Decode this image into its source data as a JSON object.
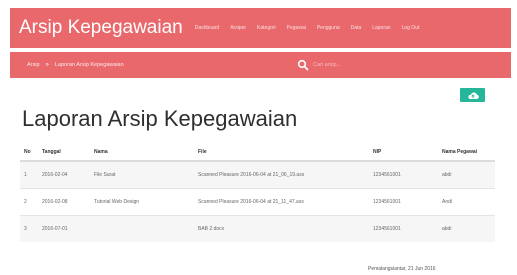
{
  "navbar": {
    "brand": "Arsip Kepegawaian",
    "links": [
      "Dashboard",
      "Arsiper",
      "Kategori",
      "Pegawai",
      "Pengguna",
      "Data",
      "Laporan",
      "Log Out"
    ]
  },
  "breadcrumb": {
    "home": "Arsip",
    "separator": "»",
    "current": "Laporan Arsip Kepegawaian"
  },
  "search": {
    "placeholder": "Cari arsip..."
  },
  "page": {
    "title": "Laporan Arsip Kepegawaian",
    "footer_note": "Pemalangsiantar, 21 Jun 2016"
  },
  "table": {
    "headers": [
      "No",
      "Tanggal",
      "Nama",
      "File",
      "NIP",
      "Nama Pegawai"
    ],
    "rows": [
      [
        "1",
        "2016-02-04",
        "File Surat",
        "Scanned Pleasure 2016-06-04 at 21_06_19.ass",
        "1234561001",
        "abdi"
      ],
      [
        "2",
        "2016-02-08",
        "Tutorial Web Design",
        "Scanned Pleasure 2016-06-04 at 21_11_47.ass",
        "1234561001",
        "Andi"
      ],
      [
        "3",
        "2016-07-01",
        "",
        "BAB 2.docx",
        "1234561001",
        "abdi"
      ]
    ]
  },
  "colors": {
    "primary": "#e9686c",
    "accent": "#26b79a"
  },
  "icons": {
    "search": "search-icon",
    "upload": "cloud-upload-icon"
  }
}
